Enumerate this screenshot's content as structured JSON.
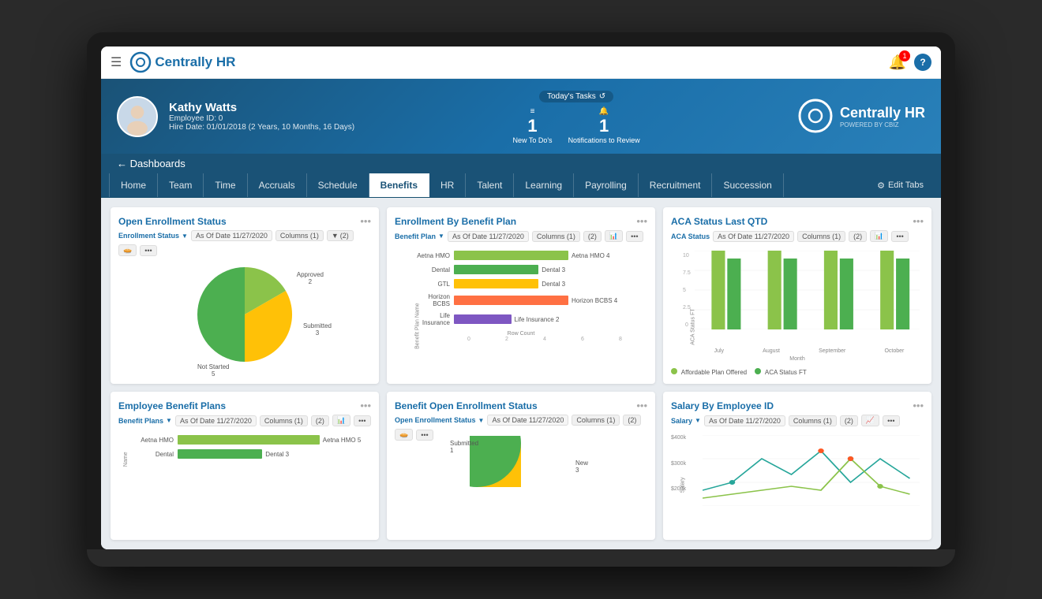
{
  "app": {
    "name": "Centrally HR"
  },
  "topnav": {
    "logo": "Centrally HR",
    "notifications_count": "1",
    "help_label": "?"
  },
  "hero": {
    "employee_name": "Kathy Watts",
    "employee_id": "Employee ID: 0",
    "hire_date": "Hire Date: 01/01/2018 (2 Years, 10 Months, 16 Days)",
    "tasks_label": "Today's Tasks",
    "new_todos_count": "1",
    "new_todos_label": "New To Do's",
    "notifications_count": "1",
    "notifications_label": "Notifications to Review"
  },
  "breadcrumb": {
    "back_label": "← Dashboards"
  },
  "navtabs": {
    "items": [
      {
        "label": "Home",
        "active": false
      },
      {
        "label": "Team",
        "active": false
      },
      {
        "label": "Time",
        "active": false
      },
      {
        "label": "Accruals",
        "active": false
      },
      {
        "label": "Schedule",
        "active": false
      },
      {
        "label": "Benefits",
        "active": true
      },
      {
        "label": "HR",
        "active": false
      },
      {
        "label": "Talent",
        "active": false
      },
      {
        "label": "Learning",
        "active": false
      },
      {
        "label": "Payrolling",
        "active": false
      },
      {
        "label": "Recruitment",
        "active": false
      },
      {
        "label": "Succession",
        "active": false
      }
    ],
    "edit_tabs": "Edit Tabs"
  },
  "widgets": {
    "open_enrollment": {
      "title": "Open Enrollment Status",
      "filter_label": "Enrollment Status",
      "as_of_date": "As Of Date 11/27/2020",
      "columns_label": "Columns (1)",
      "filter_count": "(2)",
      "pie_data": [
        {
          "label": "Approved",
          "value": 2,
          "color": "#8bc34a",
          "angle": 60
        },
        {
          "label": "Submitted",
          "value": 3,
          "color": "#ffc107",
          "angle": 90
        },
        {
          "label": "Not Started",
          "value": 5,
          "color": "#4caf50",
          "angle": 150
        }
      ]
    },
    "enrollment_by_plan": {
      "title": "Enrollment By Benefit Plan",
      "filter_label": "Benefit Plan",
      "as_of_date": "As Of Date 11/27/2020",
      "columns_label": "Columns (1)",
      "filter_count": "(2)",
      "y_axis_label": "Benefit Plan Name",
      "x_axis_label": "Row Count",
      "bars": [
        {
          "label": "Aetna HMO",
          "value": 4,
          "max": 8,
          "color": "#8bc34a",
          "val_label": "Aetna HMO 4"
        },
        {
          "label": "Dental",
          "value": 3,
          "max": 8,
          "color": "#4caf50",
          "val_label": "Dental 3"
        },
        {
          "label": "GTL",
          "value": 3,
          "max": 8,
          "color": "#ffc107",
          "val_label": "Dental 3"
        },
        {
          "label": "Horizon BCBS",
          "value": 4,
          "max": 8,
          "color": "#ff7043",
          "val_label": "Horizon BCBS 4"
        },
        {
          "label": "Life Insurance",
          "value": 2,
          "max": 8,
          "color": "#7e57c2",
          "val_label": "Life Insurance 2"
        }
      ]
    },
    "aca_status": {
      "title": "ACA Status Last QTD",
      "filter_label": "ACA Status",
      "as_of_date": "As Of Date 11/27/2020",
      "columns_label": "Columns (1)",
      "filter_count": "(2)",
      "y_axis_label": "ACA Status FT",
      "x_axis_label": "Month",
      "groups": [
        {
          "month": "July",
          "affordable": 10,
          "ft": 9
        },
        {
          "month": "August",
          "affordable": 10,
          "ft": 9
        },
        {
          "month": "September",
          "affordable": 10,
          "ft": 9
        },
        {
          "month": "October",
          "affordable": 10,
          "ft": 9
        }
      ],
      "legend": [
        {
          "label": "Affordable Plan Offered",
          "color": "#8bc34a"
        },
        {
          "label": "ACA Status FT",
          "color": "#4caf50"
        }
      ],
      "y_max": 10,
      "y_ticks": [
        "0",
        "2.5",
        "5",
        "7.5",
        "10"
      ]
    },
    "employee_benefit_plans": {
      "title": "Employee Benefit Plans",
      "filter_label": "Benefit Plans",
      "as_of_date": "As Of Date 11/27/2020",
      "columns_label": "Columns (1)",
      "filter_count": "(2)",
      "y_axis_label": "Name",
      "bars": [
        {
          "label": "Aetna HMO",
          "value": 5,
          "max": 8,
          "color": "#8bc34a",
          "val_label": "Aetna HMO 5"
        },
        {
          "label": "Dental",
          "value": 3,
          "max": 8,
          "color": "#4caf50",
          "val_label": "Dental 3"
        }
      ]
    },
    "benefit_open_enrollment": {
      "title": "Benefit Open Enrollment Status",
      "filter_label": "Open Enrollment Status",
      "as_of_date": "As Of Date 11/27/2020",
      "columns_label": "Columns (1)",
      "filter_count": "(2)",
      "pie_data": [
        {
          "label": "Submitted",
          "value": 1,
          "color": "#ffc107",
          "angle": 30
        },
        {
          "label": "New",
          "value": 3,
          "color": "#4caf50",
          "angle": 270
        }
      ]
    },
    "salary_by_employee": {
      "title": "Salary By Employee ID",
      "filter_label": "Salary",
      "as_of_date": "As Of Date 11/27/2020",
      "columns_label": "Columns (1)",
      "filter_count": "(2)",
      "y_labels": [
        "$200k",
        "$300k",
        "$400k"
      ],
      "x_labels": []
    }
  }
}
